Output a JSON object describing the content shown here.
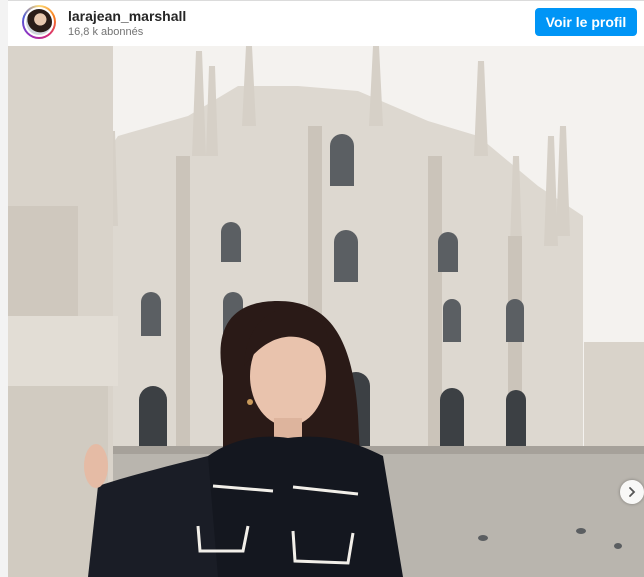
{
  "post": {
    "username": "larajean_marshall",
    "followers": "16,8 k abonnés",
    "profile_button": "Voir le profil"
  },
  "icons": {
    "avatar": "profile-avatar",
    "next": "chevron-right-icon"
  },
  "colors": {
    "primary_button": "#0095f6",
    "text": "#262626",
    "secondary_text": "#737373"
  }
}
